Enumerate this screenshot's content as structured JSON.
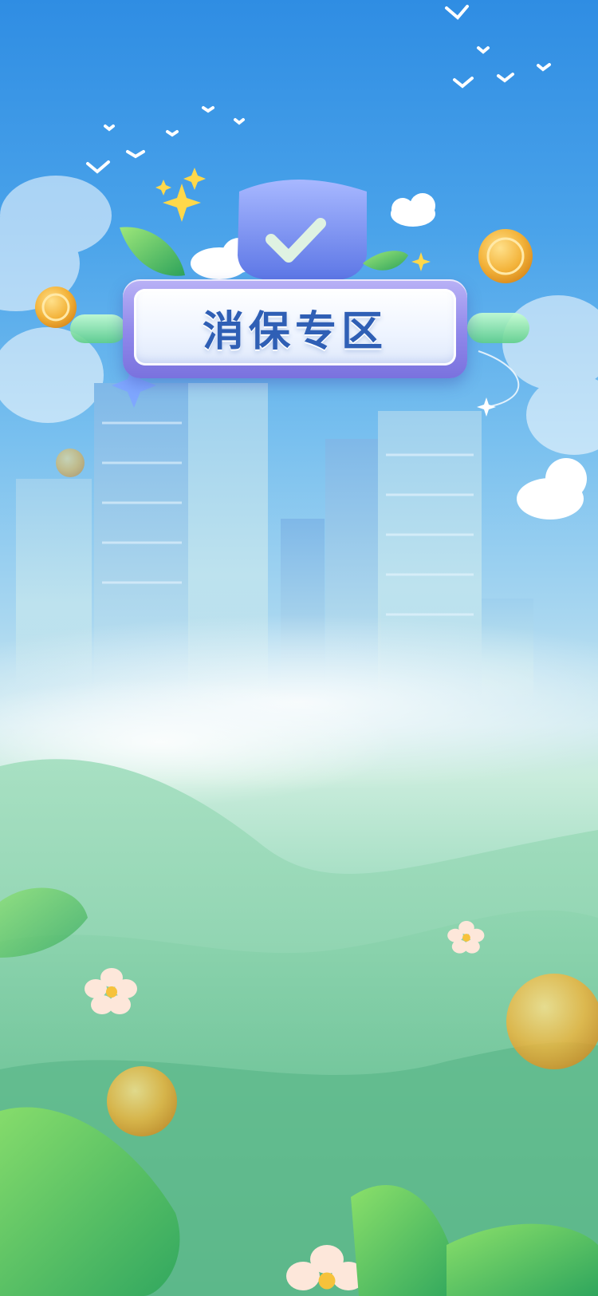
{
  "page": {
    "title": "消保专区"
  },
  "icons": {
    "shield": "shield-check-icon",
    "coin": "coin-icon",
    "sparkle": "sparkle-icon",
    "bird": "bird-icon",
    "cloud": "cloud-icon",
    "leaf": "leaf-icon",
    "flower": "flower-icon"
  },
  "colors": {
    "sky_top": "#2f8de3",
    "sky_mid": "#79c0ef",
    "grass": "#6dc59b",
    "plaque_frame": "#8f87ea",
    "title_text": "#2f5fb5",
    "coin": "#f3b33a"
  }
}
